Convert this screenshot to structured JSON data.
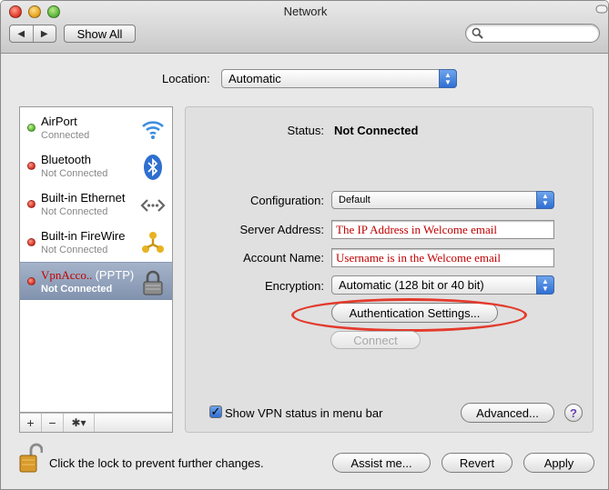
{
  "window": {
    "title": "Network"
  },
  "toolbar": {
    "back": "◀",
    "forward": "▶",
    "show_all": "Show All",
    "search_value": ""
  },
  "location": {
    "label": "Location:",
    "value": "Automatic"
  },
  "services": [
    {
      "name": "AirPort",
      "status": "Connected",
      "indicator": "green",
      "icon": "wifi-icon"
    },
    {
      "name": "Bluetooth",
      "status": "Not Connected",
      "indicator": "red",
      "icon": "bluetooth-icon"
    },
    {
      "name": "Built-in Ethernet",
      "status": "Not Connected",
      "indicator": "red",
      "icon": "ethernet-icon"
    },
    {
      "name": "Built-in FireWire",
      "status": "Not Connected",
      "indicator": "red",
      "icon": "firewire-icon"
    },
    {
      "name": "VpnAcco..",
      "name_suffix": "(PPTP)",
      "status": "Not Connected",
      "indicator": "red",
      "icon": "vpn-lock-icon",
      "selected": true
    }
  ],
  "sidebar_bar": {
    "add": "+",
    "remove": "−",
    "gear": "✱▾"
  },
  "detail": {
    "status_label": "Status:",
    "status_value": "Not Connected",
    "configuration_label": "Configuration:",
    "configuration_value": "Default",
    "server_label": "Server Address:",
    "server_value": "The IP Address in Welcome email",
    "account_label": "Account Name:",
    "account_value": "Username is in the Welcome email",
    "encryption_label": "Encryption:",
    "encryption_value": "Automatic (128 bit or 40 bit)",
    "auth_button": "Authentication Settings...",
    "connect_button": "Connect",
    "show_vpn_label": "Show VPN status in menu bar",
    "show_vpn_checked": true,
    "advanced_button": "Advanced...",
    "help": "?"
  },
  "footer": {
    "lock_text": "Click the lock to prevent further changes.",
    "assist_button": "Assist me...",
    "revert_button": "Revert",
    "apply_button": "Apply"
  },
  "colors": {
    "accent_blue": "#2f6fd3",
    "annotation_red": "#e33a2c",
    "typed_red": "#c10000",
    "selection": "#8192ae"
  }
}
